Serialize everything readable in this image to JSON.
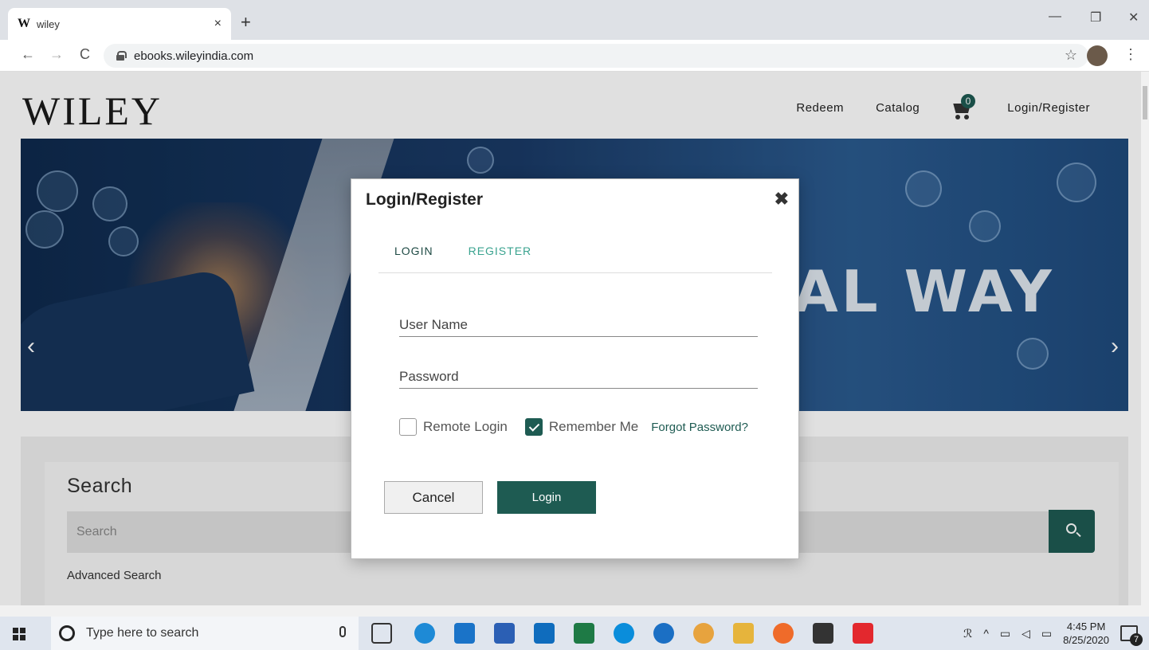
{
  "browser": {
    "tab_title": "wiley",
    "tab_favicon": "W",
    "tab_close": "×",
    "new_tab": "+",
    "url": "ebooks.wileyindia.com",
    "back": "←",
    "forward": "→",
    "reload": "C",
    "minimize": "—",
    "maximize": "❐",
    "close": "✕",
    "star": "☆",
    "menu": "⋮"
  },
  "header": {
    "logo": "WILEY",
    "nav": [
      "Redeem",
      "Catalog"
    ],
    "cart_count": "0",
    "login_register": "Login/Register"
  },
  "banner": {
    "text": "AL WAY",
    "prev": "‹",
    "next": "›"
  },
  "search": {
    "title": "Search",
    "placeholder": "Search",
    "advanced": "Advanced Search"
  },
  "modal": {
    "title": "Login/Register",
    "close": "✖",
    "tabs": [
      "LOGIN",
      "REGISTER"
    ],
    "username_placeholder": "User Name",
    "password_placeholder": "Password",
    "remote_login": "Remote Login",
    "remember_me": "Remember Me",
    "remember_checked": true,
    "remote_checked": false,
    "forgot": "Forgot Password?",
    "cancel": "Cancel",
    "login": "Login"
  },
  "taskbar": {
    "search_placeholder": "Type here to search",
    "time": "4:45 PM",
    "date": "8/25/2020",
    "notifications": "7",
    "apps": [
      "task-view-icon",
      "edge-icon",
      "mail-icon",
      "word-icon",
      "outlook-icon",
      "excel-icon",
      "skype-icon",
      "ie-icon",
      "chrome-icon",
      "file-explorer-icon",
      "firefox-icon",
      "store-icon",
      "airtel-icon"
    ]
  },
  "colors": {
    "brand": "#1e5b52",
    "accent_link": "#3aa38f"
  }
}
